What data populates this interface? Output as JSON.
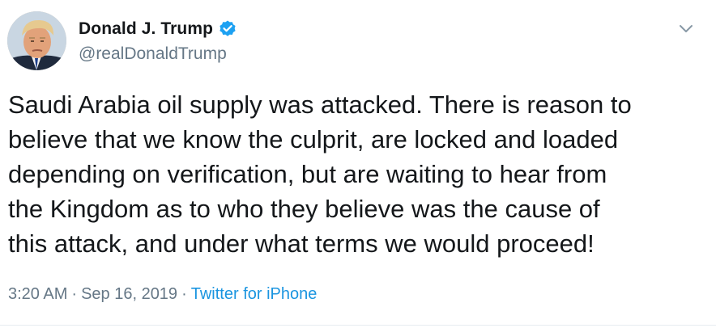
{
  "author": {
    "display_name": "Donald J. Trump",
    "handle": "@realDonaldTrump",
    "verified": true
  },
  "tweet": {
    "text": "Saudi Arabia oil supply was attacked. There is reason to\nbelieve that we know the culprit, are locked and loaded\ndepending on verification, but are waiting to hear from\nthe Kingdom as to who they believe was the cause of\nthis attack, and under what terms we would proceed!",
    "time": "3:20 AM",
    "date": "Sep 16, 2019",
    "separator": "·",
    "source": "Twitter for iPhone"
  },
  "icons": {
    "verified": "verified-badge-icon",
    "menu": "chevron-down-icon"
  },
  "colors": {
    "name": "#14171a",
    "secondary": "#657786",
    "link": "#1b95e0",
    "verified": "#1da1f2"
  }
}
